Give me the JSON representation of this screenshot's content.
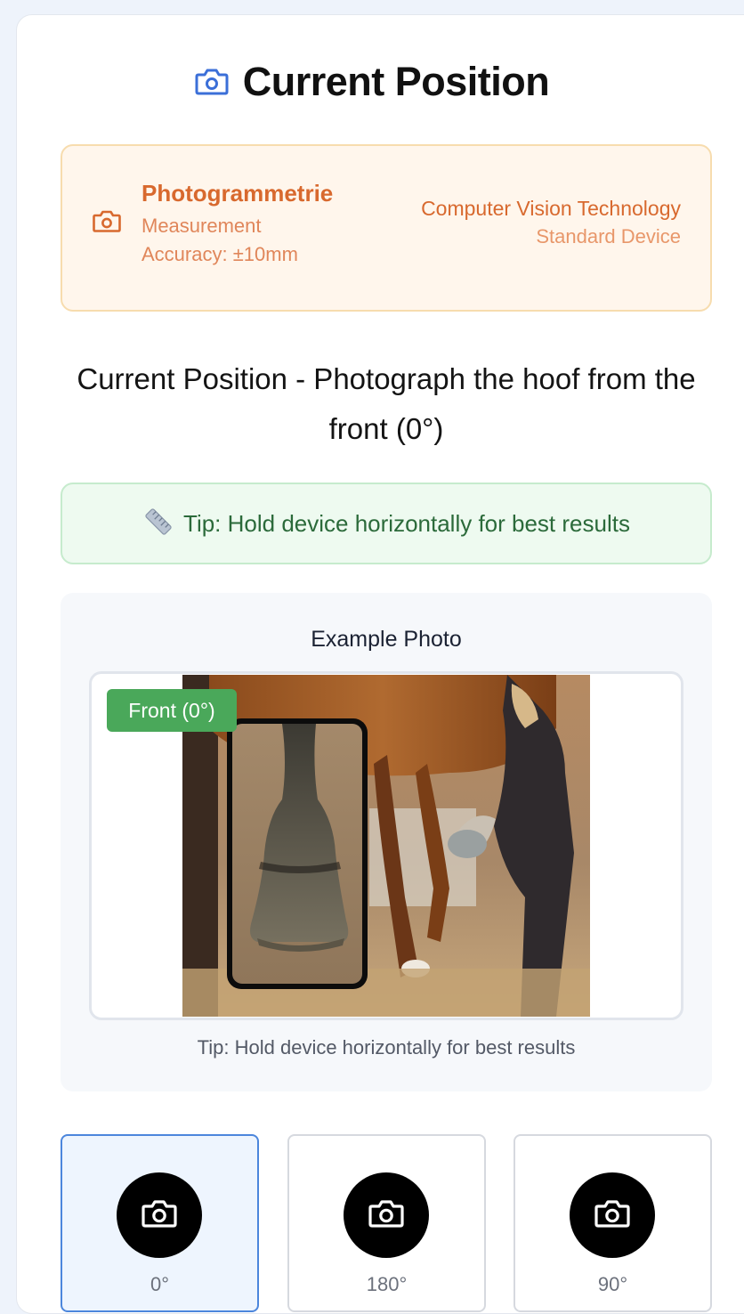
{
  "header": {
    "title": "Current Position",
    "icon": "camera-icon",
    "accent": "#3b6fd8"
  },
  "method": {
    "icon": "camera-icon",
    "name": "Photogrammetrie",
    "measurement_line1": "Measurement",
    "measurement_line2": "Accuracy: ±10mm",
    "technology": "Computer Vision Technology",
    "device": "Standard Device",
    "accent": "#d8692e"
  },
  "instruction": "Current Position - Photograph the hoof from the front (0°)",
  "tip": {
    "icon": "ruler-icon",
    "text": "Tip: Hold device horizontally for best results"
  },
  "example": {
    "title": "Example Photo",
    "badge": "Front (0°)",
    "badge_color": "#4aa85a",
    "caption": "Tip: Hold device horizontally for best results"
  },
  "angles": [
    {
      "label": "0°",
      "icon": "camera-icon",
      "selected": true
    },
    {
      "label": "180°",
      "icon": "camera-icon",
      "selected": false
    },
    {
      "label": "90°",
      "icon": "camera-icon",
      "selected": false
    }
  ]
}
